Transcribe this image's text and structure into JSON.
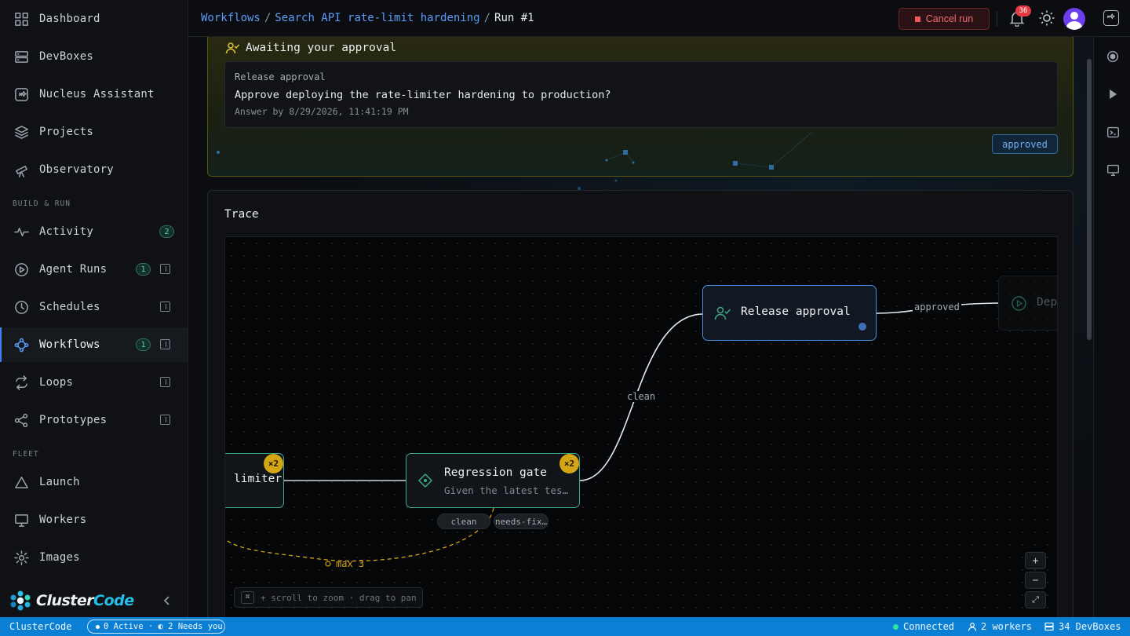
{
  "sidebar": {
    "items": [
      {
        "label": "Dashboard",
        "icon": "grid-icon"
      },
      {
        "label": "DevBoxes",
        "icon": "server-icon"
      },
      {
        "label": "Nucleus Assistant",
        "icon": "assistant-icon"
      },
      {
        "label": "Projects",
        "icon": "layers-icon"
      },
      {
        "label": "Observatory",
        "icon": "telescope-icon"
      },
      {
        "label": "Activity",
        "icon": "pulse-icon",
        "badge": "2"
      },
      {
        "label": "Agent Runs",
        "icon": "play-circle-icon",
        "badge": "1"
      },
      {
        "label": "Schedules",
        "icon": "clock-icon"
      },
      {
        "label": "Workflows",
        "icon": "workflow-icon",
        "badge": "1",
        "active": true
      },
      {
        "label": "Loops",
        "icon": "loop-icon"
      },
      {
        "label": "Prototypes",
        "icon": "share-icon"
      },
      {
        "label": "Launch",
        "icon": "triangle-icon"
      },
      {
        "label": "Workers",
        "icon": "monitor-icon"
      },
      {
        "label": "Images",
        "icon": "cog-icon"
      }
    ],
    "sections": {
      "build": "BUILD & RUN",
      "fleet": "FLEET"
    },
    "brand": {
      "prefix": "Cluster",
      "suffix": "Code"
    }
  },
  "header": {
    "breadcrumbs": [
      "Workflows",
      "Search API rate-limit hardening"
    ],
    "current": "Run #1",
    "separator": "/",
    "cancel_label": "Cancel run",
    "notification_count": "36"
  },
  "approval": {
    "title": "Awaiting your approval",
    "kind": "Release approval",
    "question": "Approve deploying the rate-limiter hardening to production?",
    "due": "Answer by 8/29/2026, 11:41:19 PM",
    "status": "approved"
  },
  "trace": {
    "title": "Trace",
    "nodes": {
      "limiter": {
        "name": "limiter",
        "count": "×2"
      },
      "regression": {
        "name": "Regression gate",
        "desc": "Given the latest tes…",
        "count": "×2",
        "outputs": [
          "clean",
          "needs-fix…"
        ]
      },
      "release": {
        "name": "Release approval"
      },
      "deploy": {
        "name": "Dep"
      }
    },
    "edge_labels": {
      "clean": "clean",
      "approved": "approved",
      "loop": "max 3"
    },
    "zoom": {
      "in": "+",
      "out": "−",
      "fit": "⤢"
    },
    "hint_key": "⌘",
    "hint": "+ scroll to zoom · drag to pan"
  },
  "statusbar": {
    "app": "ClusterCode",
    "activity": "0 Active · ◐ 2 Needs you",
    "connection": "Connected",
    "workers": "2 workers",
    "devboxes": "34 DevBoxes"
  },
  "colors": {
    "accent": "#3b82f6",
    "status_bar": "#0a7fd4",
    "approval_border": "#5a5413",
    "node_active": "#4a8fe0",
    "node_done": "#3ea88a"
  }
}
